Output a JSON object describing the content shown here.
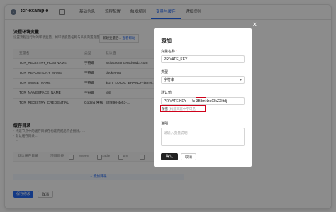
{
  "topbar": {
    "back_icon": "arrow-left-icon",
    "project_name": "tcr-example",
    "tabs": [
      {
        "label": "基础信息",
        "active": false
      },
      {
        "label": "流程配置",
        "active": false
      },
      {
        "label": "触发规则",
        "active": false
      },
      {
        "label": "变量与缓存",
        "active": true
      },
      {
        "label": "通知规则",
        "active": false
      }
    ]
  },
  "env_section": {
    "title": "流程环境变量",
    "desc": "设置流程运行时的环境变量，如环境变量名称与系统内置变量同名…",
    "tip": {
      "text": "新建变量后...",
      "link": "查看帮助"
    },
    "headers": [
      "变量名",
      "类型",
      "默认值"
    ],
    "rows": [
      {
        "name": "TCR_REGISTRY_HOSTNAME",
        "type": "字符串",
        "value": "artifacts.tencentcloudcr.com"
      },
      {
        "name": "TCR_REPOSITORY_NAME",
        "type": "字符串",
        "value": "docker-go"
      },
      {
        "name": "TCR_IMAGE_NAME",
        "type": "字符串",
        "value": "$GIT_LOCAL_BRANCH-$env(…"
      },
      {
        "name": "TCR_NAMESPACE_NAME",
        "type": "字符串",
        "value": "test"
      },
      {
        "name": "TCR_REGISTRY_CREDENTIAL",
        "type": "Coding 凭据",
        "value": "82f9f90-4e53-…"
      }
    ]
  },
  "cache_section": {
    "title": "缓存目录",
    "desc": [
      "· 构建节点中的缓存目录在构建完成后不会删除，...",
      "· 默认缓存目录 ...",
      "· ..."
    ],
    "headers": [
      "默认缓存目录",
      "项目目录",
      "Maven",
      "Gradle",
      "npm"
    ],
    "add_label": "+ 添加目录"
  },
  "footer": {
    "save_label": "保存修改",
    "cancel_label": "取消"
  },
  "dialog": {
    "title": "添加",
    "close_icon": "close-icon",
    "name_label": "变量名称",
    "name_value": "PRIVATE_KEY",
    "type_label": "类型",
    "type_value": "字符串",
    "default_label": "默认值",
    "default_value": "PRIVATE KEY-----\\n-3BlbnNzaCIkZXktdj",
    "secret_label": "保密",
    "secret_hint": "(构建日志中不可见)",
    "desc_label": "说明",
    "desc_placeholder": "请输入变量说明",
    "confirm_label": "确认",
    "cancel_label": "取消"
  }
}
